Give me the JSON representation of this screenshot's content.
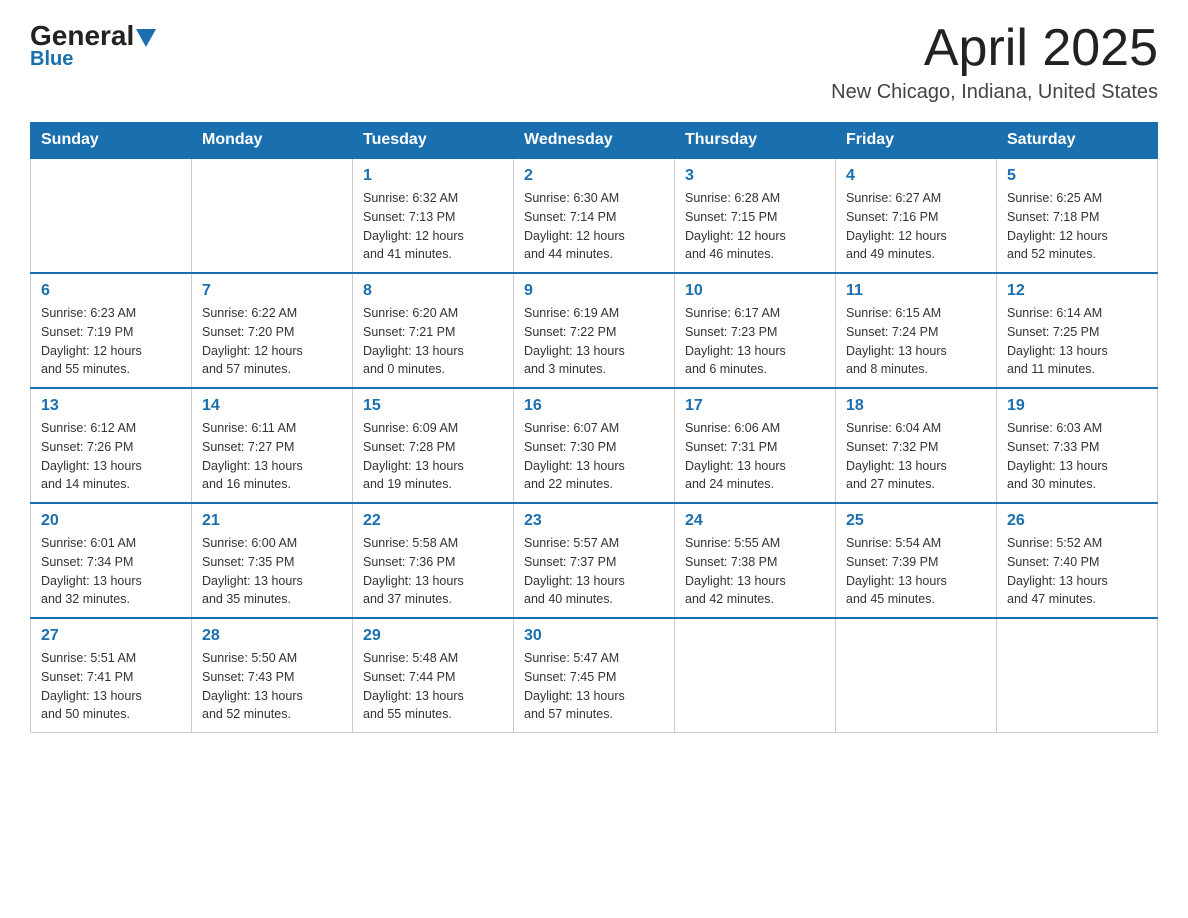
{
  "header": {
    "logo_text": "General",
    "logo_blue": "Blue",
    "month_title": "April 2025",
    "location": "New Chicago, Indiana, United States"
  },
  "days_of_week": [
    "Sunday",
    "Monday",
    "Tuesday",
    "Wednesday",
    "Thursday",
    "Friday",
    "Saturday"
  ],
  "weeks": [
    [
      {
        "day": "",
        "info": ""
      },
      {
        "day": "",
        "info": ""
      },
      {
        "day": "1",
        "info": "Sunrise: 6:32 AM\nSunset: 7:13 PM\nDaylight: 12 hours\nand 41 minutes."
      },
      {
        "day": "2",
        "info": "Sunrise: 6:30 AM\nSunset: 7:14 PM\nDaylight: 12 hours\nand 44 minutes."
      },
      {
        "day": "3",
        "info": "Sunrise: 6:28 AM\nSunset: 7:15 PM\nDaylight: 12 hours\nand 46 minutes."
      },
      {
        "day": "4",
        "info": "Sunrise: 6:27 AM\nSunset: 7:16 PM\nDaylight: 12 hours\nand 49 minutes."
      },
      {
        "day": "5",
        "info": "Sunrise: 6:25 AM\nSunset: 7:18 PM\nDaylight: 12 hours\nand 52 minutes."
      }
    ],
    [
      {
        "day": "6",
        "info": "Sunrise: 6:23 AM\nSunset: 7:19 PM\nDaylight: 12 hours\nand 55 minutes."
      },
      {
        "day": "7",
        "info": "Sunrise: 6:22 AM\nSunset: 7:20 PM\nDaylight: 12 hours\nand 57 minutes."
      },
      {
        "day": "8",
        "info": "Sunrise: 6:20 AM\nSunset: 7:21 PM\nDaylight: 13 hours\nand 0 minutes."
      },
      {
        "day": "9",
        "info": "Sunrise: 6:19 AM\nSunset: 7:22 PM\nDaylight: 13 hours\nand 3 minutes."
      },
      {
        "day": "10",
        "info": "Sunrise: 6:17 AM\nSunset: 7:23 PM\nDaylight: 13 hours\nand 6 minutes."
      },
      {
        "day": "11",
        "info": "Sunrise: 6:15 AM\nSunset: 7:24 PM\nDaylight: 13 hours\nand 8 minutes."
      },
      {
        "day": "12",
        "info": "Sunrise: 6:14 AM\nSunset: 7:25 PM\nDaylight: 13 hours\nand 11 minutes."
      }
    ],
    [
      {
        "day": "13",
        "info": "Sunrise: 6:12 AM\nSunset: 7:26 PM\nDaylight: 13 hours\nand 14 minutes."
      },
      {
        "day": "14",
        "info": "Sunrise: 6:11 AM\nSunset: 7:27 PM\nDaylight: 13 hours\nand 16 minutes."
      },
      {
        "day": "15",
        "info": "Sunrise: 6:09 AM\nSunset: 7:28 PM\nDaylight: 13 hours\nand 19 minutes."
      },
      {
        "day": "16",
        "info": "Sunrise: 6:07 AM\nSunset: 7:30 PM\nDaylight: 13 hours\nand 22 minutes."
      },
      {
        "day": "17",
        "info": "Sunrise: 6:06 AM\nSunset: 7:31 PM\nDaylight: 13 hours\nand 24 minutes."
      },
      {
        "day": "18",
        "info": "Sunrise: 6:04 AM\nSunset: 7:32 PM\nDaylight: 13 hours\nand 27 minutes."
      },
      {
        "day": "19",
        "info": "Sunrise: 6:03 AM\nSunset: 7:33 PM\nDaylight: 13 hours\nand 30 minutes."
      }
    ],
    [
      {
        "day": "20",
        "info": "Sunrise: 6:01 AM\nSunset: 7:34 PM\nDaylight: 13 hours\nand 32 minutes."
      },
      {
        "day": "21",
        "info": "Sunrise: 6:00 AM\nSunset: 7:35 PM\nDaylight: 13 hours\nand 35 minutes."
      },
      {
        "day": "22",
        "info": "Sunrise: 5:58 AM\nSunset: 7:36 PM\nDaylight: 13 hours\nand 37 minutes."
      },
      {
        "day": "23",
        "info": "Sunrise: 5:57 AM\nSunset: 7:37 PM\nDaylight: 13 hours\nand 40 minutes."
      },
      {
        "day": "24",
        "info": "Sunrise: 5:55 AM\nSunset: 7:38 PM\nDaylight: 13 hours\nand 42 minutes."
      },
      {
        "day": "25",
        "info": "Sunrise: 5:54 AM\nSunset: 7:39 PM\nDaylight: 13 hours\nand 45 minutes."
      },
      {
        "day": "26",
        "info": "Sunrise: 5:52 AM\nSunset: 7:40 PM\nDaylight: 13 hours\nand 47 minutes."
      }
    ],
    [
      {
        "day": "27",
        "info": "Sunrise: 5:51 AM\nSunset: 7:41 PM\nDaylight: 13 hours\nand 50 minutes."
      },
      {
        "day": "28",
        "info": "Sunrise: 5:50 AM\nSunset: 7:43 PM\nDaylight: 13 hours\nand 52 minutes."
      },
      {
        "day": "29",
        "info": "Sunrise: 5:48 AM\nSunset: 7:44 PM\nDaylight: 13 hours\nand 55 minutes."
      },
      {
        "day": "30",
        "info": "Sunrise: 5:47 AM\nSunset: 7:45 PM\nDaylight: 13 hours\nand 57 minutes."
      },
      {
        "day": "",
        "info": ""
      },
      {
        "day": "",
        "info": ""
      },
      {
        "day": "",
        "info": ""
      }
    ]
  ],
  "accent_color": "#1a6faf"
}
